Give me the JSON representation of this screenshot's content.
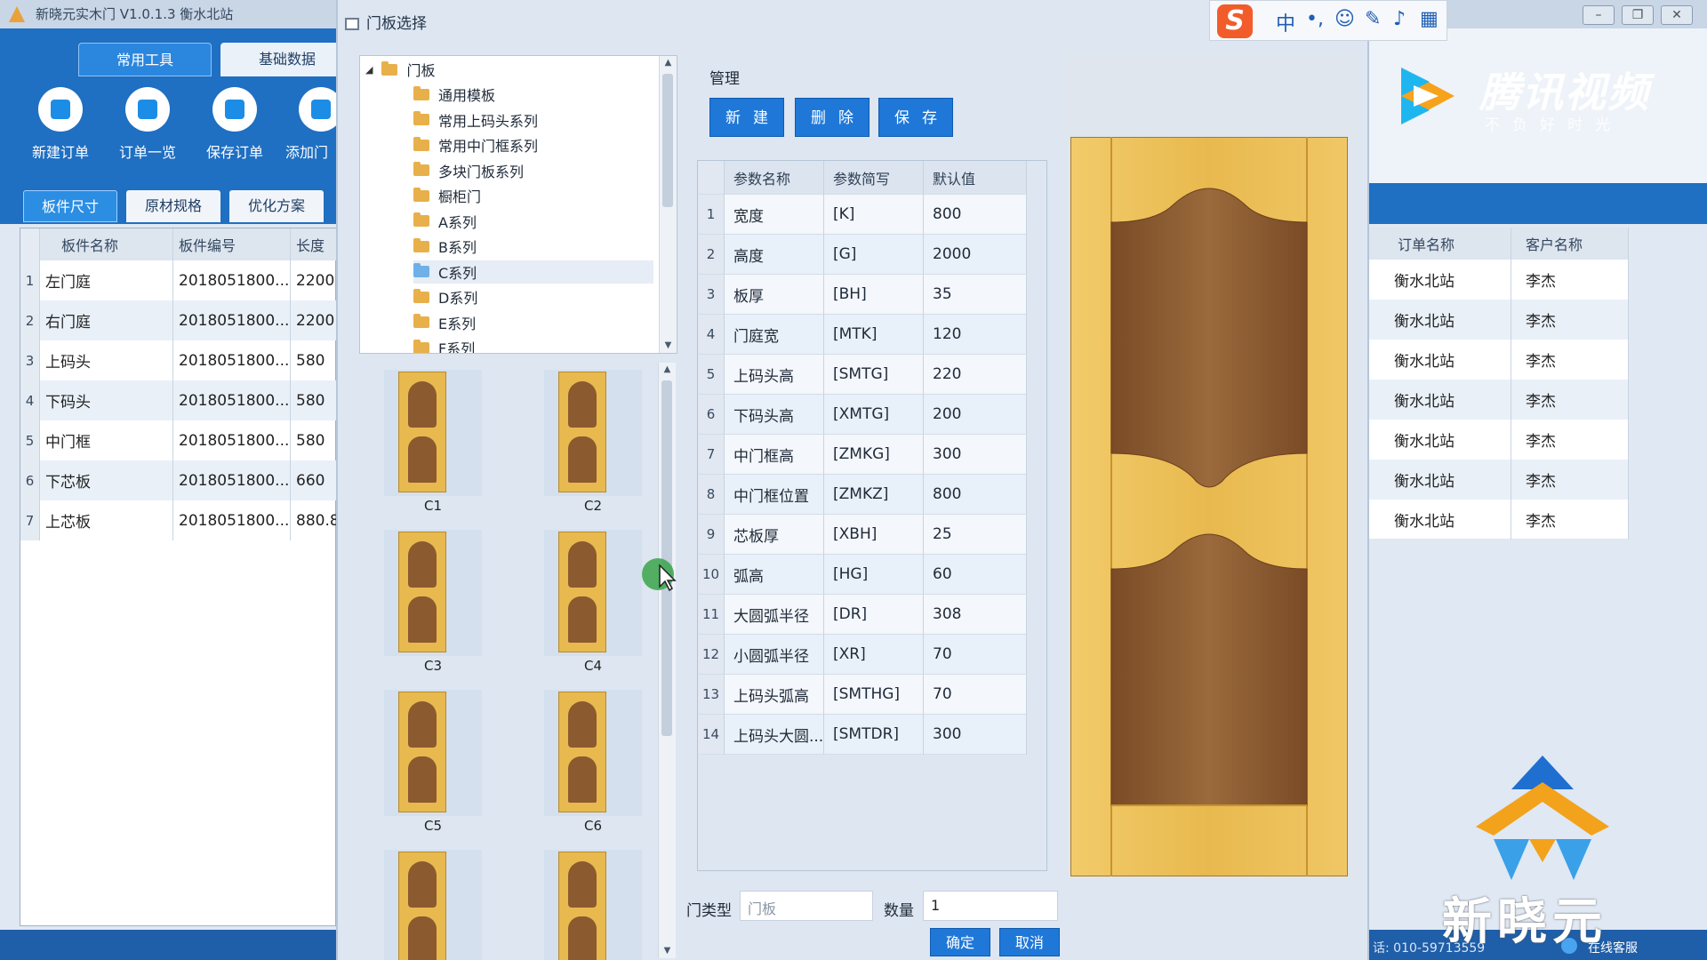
{
  "main_window": {
    "title": "新晓元实木门 V1.0.1.3 衡水北站",
    "tabs": [
      "常用工具",
      "基础数据"
    ],
    "toolbar": [
      "新建订单",
      "订单一览",
      "保存订单",
      "添加门"
    ],
    "subtabs": [
      "板件尺寸",
      "原材规格",
      "优化方案"
    ],
    "left_table": {
      "columns": [
        "板件名称",
        "板件编号",
        "长度"
      ],
      "rows": [
        {
          "n": "1",
          "name": "左门庭",
          "code": "2018051800...",
          "len": "2200"
        },
        {
          "n": "2",
          "name": "右门庭",
          "code": "2018051800...",
          "len": "2200"
        },
        {
          "n": "3",
          "name": "上码头",
          "code": "2018051800...",
          "len": "580"
        },
        {
          "n": "4",
          "name": "下码头",
          "code": "2018051800...",
          "len": "580"
        },
        {
          "n": "5",
          "name": "中门框",
          "code": "2018051800...",
          "len": "580"
        },
        {
          "n": "6",
          "name": "下芯板",
          "code": "2018051800...",
          "len": "660"
        },
        {
          "n": "7",
          "name": "上芯板",
          "code": "2018051800...",
          "len": "880.8"
        }
      ]
    },
    "right_table": {
      "columns": [
        "订单名称",
        "客户名称"
      ],
      "rows": [
        [
          "衡水北站",
          "李杰"
        ],
        [
          "衡水北站",
          "李杰"
        ],
        [
          "衡水北站",
          "李杰"
        ],
        [
          "衡水北站",
          "李杰"
        ],
        [
          "衡水北站",
          "李杰"
        ],
        [
          "衡水北站",
          "李杰"
        ],
        [
          "衡水北站",
          "李杰"
        ]
      ]
    },
    "status": {
      "phone": "话: 010-59713559",
      "service": "在线客服"
    }
  },
  "dialog": {
    "title": "门板选择",
    "tree": {
      "root": "门板",
      "items": [
        "通用模板",
        "常用上码头系列",
        "常用中门框系列",
        "多块门板系列",
        "橱柜门",
        "A系列",
        "B系列",
        "C系列",
        "D系列",
        "E系列",
        "F系列"
      ],
      "selected": "C系列"
    },
    "thumbnails": [
      "C1",
      "C2",
      "C3",
      "C4",
      "C5",
      "C6",
      "",
      ""
    ],
    "manage": {
      "label": "管理",
      "new": "新建",
      "delete": "删除",
      "save": "保存"
    },
    "params": {
      "columns": [
        "参数名称",
        "参数简写",
        "默认值"
      ],
      "rows": [
        {
          "n": "1",
          "name": "宽度",
          "abbr": "[K]",
          "val": "800"
        },
        {
          "n": "2",
          "name": "高度",
          "abbr": "[G]",
          "val": "2000"
        },
        {
          "n": "3",
          "name": "板厚",
          "abbr": "[BH]",
          "val": "35"
        },
        {
          "n": "4",
          "name": "门庭宽",
          "abbr": "[MTK]",
          "val": "120"
        },
        {
          "n": "5",
          "name": "上码头高",
          "abbr": "[SMTG]",
          "val": "220"
        },
        {
          "n": "6",
          "name": "下码头高",
          "abbr": "[XMTG]",
          "val": "200"
        },
        {
          "n": "7",
          "name": "中门框高",
          "abbr": "[ZMKG]",
          "val": "300"
        },
        {
          "n": "8",
          "name": "中门框位置",
          "abbr": "[ZMKZ]",
          "val": "800"
        },
        {
          "n": "9",
          "name": "芯板厚",
          "abbr": "[XBH]",
          "val": "25"
        },
        {
          "n": "10",
          "name": "弧高",
          "abbr": "[HG]",
          "val": "60"
        },
        {
          "n": "11",
          "name": "大圆弧半径",
          "abbr": "[DR]",
          "val": "308"
        },
        {
          "n": "12",
          "name": "小圆弧半径",
          "abbr": "[XR]",
          "val": "70"
        },
        {
          "n": "13",
          "name": "上码头弧高",
          "abbr": "[SMTHG]",
          "val": "70"
        },
        {
          "n": "14",
          "name": "上码头大圆...",
          "abbr": "[SMTDR]",
          "val": "300"
        }
      ]
    },
    "door_type_label": "门类型",
    "door_type_value": "门板",
    "qty_label": "数量",
    "qty_value": "1",
    "ok": "确定",
    "cancel": "取消"
  },
  "ime": {
    "logo": "S",
    "lang": "中"
  },
  "watermarks": {
    "video_brand": "腾讯视频",
    "video_slogan": "不负好时光",
    "company": "新晓元"
  },
  "colors": {
    "accent": "#1f78d8",
    "header_blue": "#1f6fc2",
    "door_frame": "#e8b94e",
    "door_panel": "#8b5a2f"
  }
}
